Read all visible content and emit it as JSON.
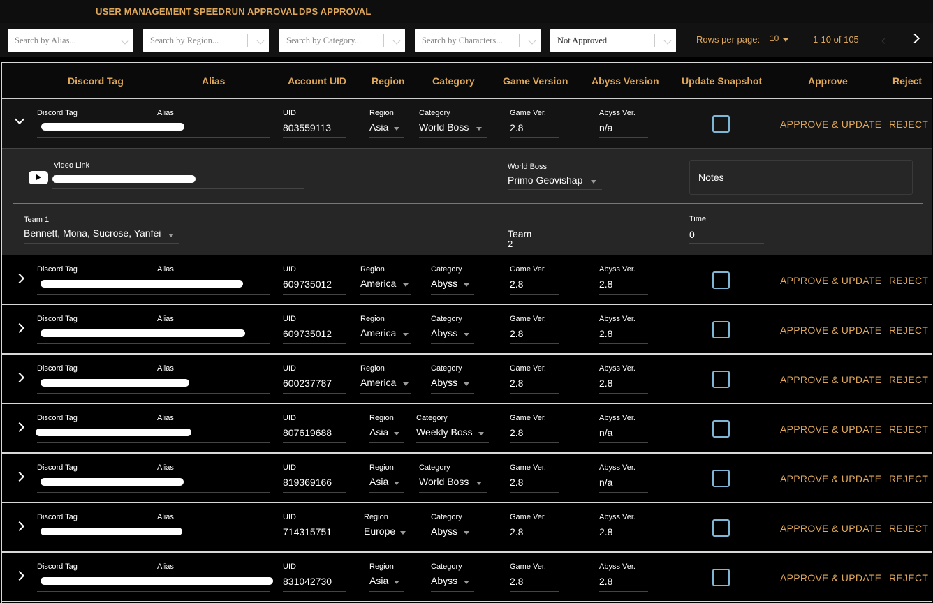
{
  "nav": [
    "USER MANAGEMENT",
    "SPEEDRUN APPROVAL",
    "DPS APPROVAL"
  ],
  "filters": {
    "alias": "Search by Alias...",
    "region": "Search by Region...",
    "category": "Search by Category...",
    "characters": "Search by Characters...",
    "status": "Not Approved"
  },
  "pagination": {
    "rows_label": "Rows per page:",
    "rows_value": "10",
    "range": "1-10 of 105"
  },
  "columns": [
    "Discord Tag",
    "Alias",
    "Account UID",
    "Region",
    "Category",
    "Game Version",
    "Abyss Version",
    "Update Snapshot",
    "Approve",
    "Reject"
  ],
  "field_labels": {
    "discord": "Discord Tag",
    "alias": "Alias",
    "uid": "UID",
    "region": "Region",
    "category": "Category",
    "game": "Game Ver.",
    "abyss": "Abyss Ver."
  },
  "actions": {
    "approve": "APPROVE & UPDATE",
    "reject": "REJECT"
  },
  "rows": [
    {
      "uid": "803559113",
      "region": "Asia",
      "category": "World Boss",
      "game": "2.8",
      "abyss": "n/a",
      "expanded": true
    },
    {
      "uid": "609735012",
      "region": "America",
      "category": "Abyss",
      "game": "2.8",
      "abyss": "2.8"
    },
    {
      "uid": "609735012",
      "region": "America",
      "category": "Abyss",
      "game": "2.8",
      "abyss": "2.8"
    },
    {
      "uid": "600237787",
      "region": "America",
      "category": "Abyss",
      "game": "2.8",
      "abyss": "2.8"
    },
    {
      "uid": "807619688",
      "region": "Asia",
      "category": "Weekly Boss",
      "game": "2.8",
      "abyss": "n/a"
    },
    {
      "uid": "819369166",
      "region": "Asia",
      "category": "World Boss",
      "game": "2.8",
      "abyss": "n/a"
    },
    {
      "uid": "714315751",
      "region": "Europe",
      "category": "Abyss",
      "game": "2.8",
      "abyss": "2.8"
    },
    {
      "uid": "831042730",
      "region": "Asia",
      "category": "Abyss",
      "game": "2.8",
      "abyss": "2.8"
    }
  ],
  "detail": {
    "video_label": "Video Link",
    "boss_label": "World Boss",
    "boss_value": "Primo Geovishap",
    "notes_label": "Notes",
    "team1_label": "Team 1",
    "team1_value": "Bennett, Mona, Sucrose, Yanfei",
    "team2_label": "Team",
    "team2_value": "2",
    "time_label": "Time",
    "time_value": "0"
  }
}
